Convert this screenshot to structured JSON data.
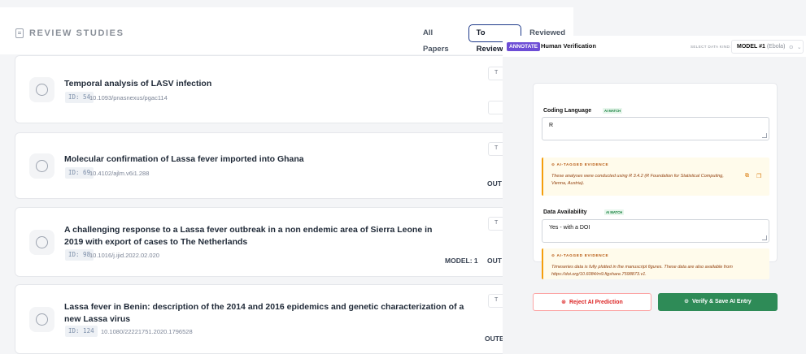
{
  "header": {
    "title": "REVIEW STUDIES",
    "tabs": [
      "All Papers",
      "To Review",
      "Reviewed"
    ],
    "active_tab": "To Review"
  },
  "papers": [
    {
      "title": "Temporal analysis of LASV infection",
      "id": "ID: 54",
      "doi": "10.1093/pnasnexus/pgac114",
      "corner": "T",
      "outcome": ""
    },
    {
      "title": "Molecular confirmation of Lassa fever imported into Ghana",
      "id": "ID: 69",
      "doi": "10.4102/ajlm.v6i1.288",
      "corner": "T",
      "outcome": "OUT"
    },
    {
      "title": "A challenging response to a Lassa fever outbreak in a non endemic area of Sierra Leone in 2019 with export of cases to The Netherlands",
      "id": "ID: 98",
      "doi": "10.1016/j.ijid.2022.02.020",
      "corner": "T",
      "model": "MODEL: 1",
      "outcome": "OUT"
    },
    {
      "title": "Lassa fever in Benin: description of the 2014 and 2016 epidemics and genetic characterization of a new Lassa virus",
      "id": "ID: 124",
      "doi": "10.1080/22221751.2020.1796528",
      "corner": "T",
      "outcome": "OUTB"
    }
  ],
  "panel": {
    "badge": "ANNOTATE",
    "title": "Human Verification",
    "select_label": "SELECT DATA KIND:",
    "model_value": "MODEL #1",
    "model_sub": "(Ebola)",
    "fields": [
      {
        "label": "Coding Language",
        "ai": "AI MATCH",
        "value": "R",
        "evidence_title": "AI-TAGGED EVIDENCE",
        "evidence": "These analyses were conducted using R 3.4.2 (R Foundation for Statistical Computing, Vienna, Austria)."
      },
      {
        "label": "Data Availability",
        "ai": "AI MATCH",
        "value": "Yes - with a DOI",
        "evidence_title": "AI-TAGGED EVIDENCE",
        "evidence": "Timeseries data is fully plotted in the manuscript figures. These data are also available from https://doi.org/10.6084/m9.figshare.7598873.v1."
      }
    ],
    "reject_label": "Reject AI Prediction",
    "verify_label": "Verify & Save AI Entry"
  },
  "colors": {
    "accent": "#1e3a8a",
    "annotate": "#6d4dd6",
    "verify": "#2e8b57",
    "reject": "#dc2626",
    "evidence": "#f59e0b"
  }
}
